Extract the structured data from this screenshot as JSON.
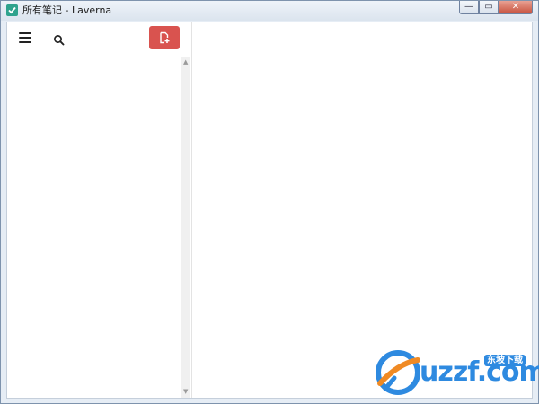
{
  "window": {
    "title": "所有笔记 - Laverna",
    "controls": {
      "minimize": "—",
      "maximize": "▭",
      "close": "✕"
    }
  },
  "sidebar": {
    "icons": {
      "menu": "hamburger-icon",
      "search": "search-icon",
      "new_note": "new-note-icon"
    }
  },
  "colors": {
    "accent": "#d9534f",
    "app_icon": "#2fa38d"
  },
  "watermark": {
    "text": "uzzf.com",
    "badge": "东坡下载"
  }
}
